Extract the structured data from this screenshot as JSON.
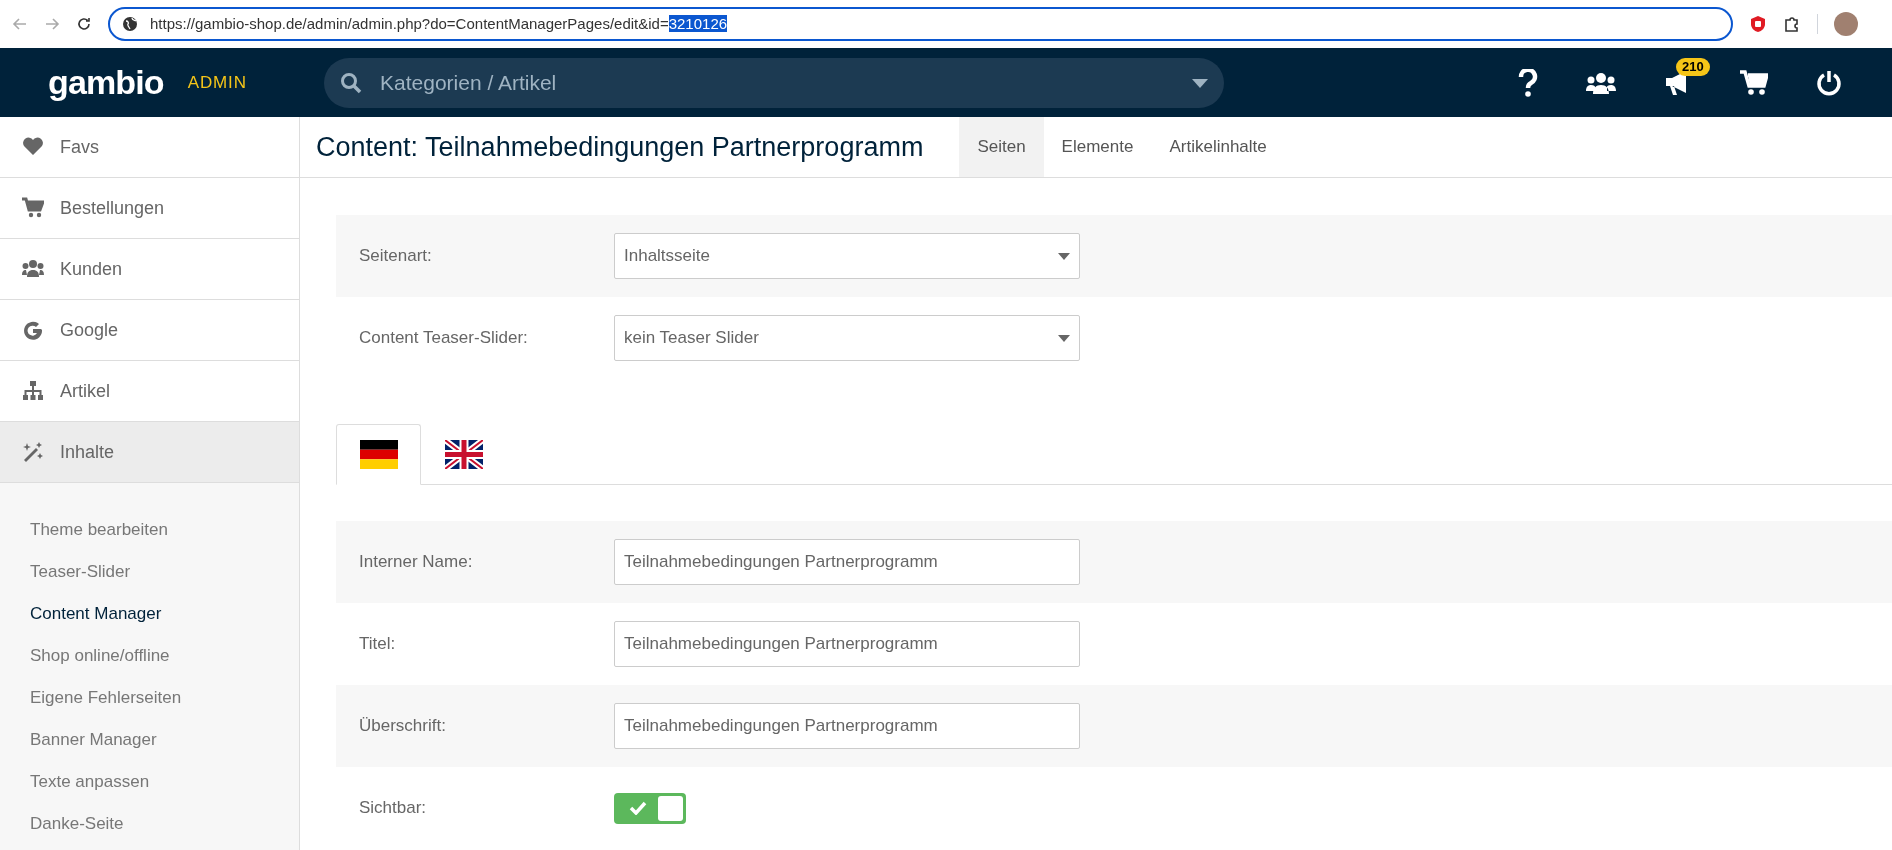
{
  "browser": {
    "url": "https://gambio-shop.de/admin/admin.php?do=ContentManagerPages/edit&id=",
    "url_selected": "3210126"
  },
  "header": {
    "logo": "gambio",
    "logo_tag": "ADMIN",
    "search": {
      "placeholder": "Kategorien / Artikel"
    },
    "notification_badge": "210"
  },
  "sidebar": {
    "items": [
      {
        "label": "Favs",
        "kind": "heart",
        "selected": false
      },
      {
        "label": "Bestellungen",
        "kind": "cart",
        "selected": false
      },
      {
        "label": "Kunden",
        "kind": "users",
        "selected": false
      },
      {
        "label": "Google",
        "kind": "google",
        "selected": false
      },
      {
        "label": "Artikel",
        "kind": "sitemap",
        "selected": false
      },
      {
        "label": "Inhalte",
        "kind": "magic",
        "selected": true,
        "expanded": true,
        "children": [
          {
            "label": "Theme bearbeiten",
            "selected": false
          },
          {
            "label": "Teaser-Slider",
            "selected": false
          },
          {
            "label": "Content Manager",
            "selected": true
          },
          {
            "label": "Shop online/offline",
            "selected": false
          },
          {
            "label": "Eigene Fehlerseiten",
            "selected": false
          },
          {
            "label": "Banner Manager",
            "selected": false
          },
          {
            "label": "Texte anpassen",
            "selected": false
          },
          {
            "label": "Danke-Seite",
            "selected": false
          }
        ]
      }
    ]
  },
  "page": {
    "title": "Content: Teilnahmebedingungen Partnerprogramm",
    "tabs": [
      {
        "label": "Seiten",
        "selected": true
      },
      {
        "label": "Elemente",
        "selected": false
      },
      {
        "label": "Artikelinhalte",
        "selected": false
      }
    ]
  },
  "settings": [
    {
      "label": "Seitenart:",
      "kind": "select",
      "value": "Inhaltsseite"
    },
    {
      "label": "Content Teaser-Slider:",
      "kind": "select",
      "value": "kein Teaser Slider"
    }
  ],
  "language_tabs": [
    {
      "kind": "german",
      "selected": true
    },
    {
      "kind": "british",
      "selected": false
    }
  ],
  "language_fields": [
    {
      "label": "Interner Name:",
      "kind": "text",
      "value": "Teilnahmebedingungen Partnerprogramm"
    },
    {
      "label": "Titel:",
      "kind": "text",
      "value": "Teilnahmebedingungen Partnerprogramm"
    },
    {
      "label": "Überschrift:",
      "kind": "text",
      "value": "Teilnahmebedingungen Partnerprogramm"
    },
    {
      "label": "Sichtbar:",
      "kind": "toggle",
      "on": true
    }
  ]
}
